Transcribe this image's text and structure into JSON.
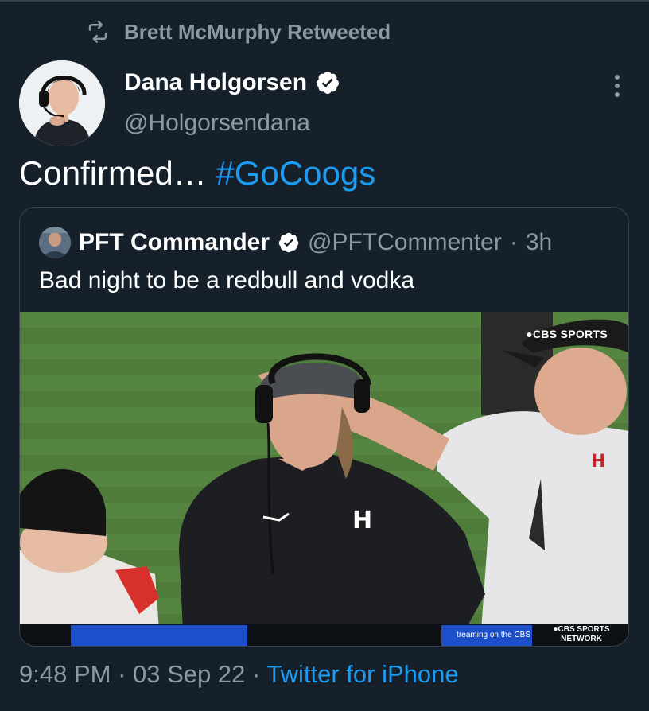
{
  "retweet_banner": {
    "label": "Brett McMurphy Retweeted",
    "icon": "retweet-icon"
  },
  "tweet": {
    "author_name": "Dana Holgorsen",
    "author_handle": "@Holgorsendana",
    "verified": true,
    "text": "Confirmed…",
    "hashtag": "#GoCoogs",
    "time": "9:48 PM",
    "date": "03 Sep 22",
    "separator": "·",
    "source": "Twitter for iPhone"
  },
  "quote": {
    "author_name": "PFT Commander",
    "author_handle": "@PFTCommenter",
    "age": "3h",
    "separator": "·",
    "verified": true,
    "text": "Bad night to be a redbull and vodka",
    "media": {
      "logo": "●CBS SPORTS",
      "ticker_stream": "treaming on the CBS",
      "ticker_network_line1": "●CBS SPORTS",
      "ticker_network_line2": "NETWORK"
    }
  },
  "colors": {
    "background": "#15202b",
    "secondary_text": "#8b98a5",
    "link": "#1d9bf0",
    "border": "#38444d"
  }
}
